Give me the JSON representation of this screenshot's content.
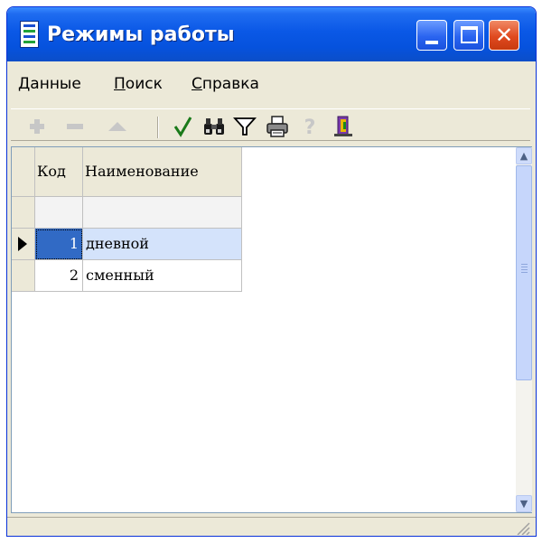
{
  "window": {
    "title": "Режимы работы"
  },
  "menu": {
    "items": [
      {
        "label": "Данные",
        "underline": "Д"
      },
      {
        "label": "Поиск",
        "underline": "П"
      },
      {
        "label": "Справка",
        "underline": "С"
      }
    ]
  },
  "toolbar": {
    "buttons": [
      {
        "icon": "plus-icon",
        "enabled": false
      },
      {
        "icon": "minus-icon",
        "enabled": false
      },
      {
        "icon": "triangle-up-icon",
        "enabled": false
      },
      {
        "icon": "checkmark-icon",
        "glyph": "√",
        "enabled": true
      },
      {
        "icon": "binoculars-icon",
        "enabled": true
      },
      {
        "icon": "filter-icon",
        "enabled": true
      },
      {
        "icon": "printer-icon",
        "enabled": true
      },
      {
        "icon": "help-icon",
        "glyph": "?",
        "enabled": false
      },
      {
        "icon": "exit-door-icon",
        "enabled": true
      }
    ]
  },
  "grid": {
    "columns": [
      "Код",
      "Наименование"
    ],
    "rows": [
      {
        "code": "1",
        "name": "дневной",
        "selected": true
      },
      {
        "code": "2",
        "name": "сменный",
        "selected": false
      }
    ]
  },
  "colors": {
    "titlebar": "#0a58e6",
    "selection": "#316ac5",
    "selected_row": "#d4e3fb",
    "window_face": "#ece9d8"
  }
}
